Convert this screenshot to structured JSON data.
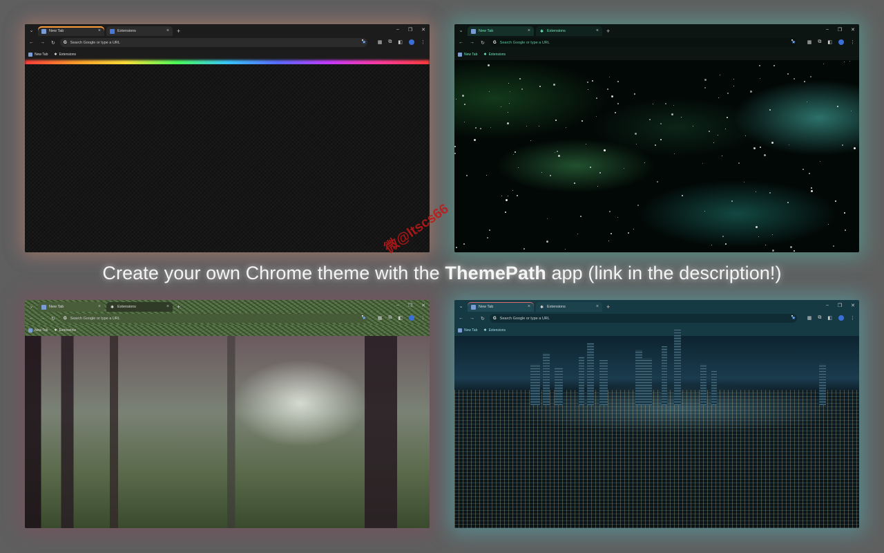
{
  "headline": {
    "before": "Create your own Chrome theme with the ",
    "app": "ThemePath",
    "after": " app (link in the description!)"
  },
  "watermark": "微@ltscs66",
  "browser": {
    "tab_new": "New Tab",
    "tab_extensions": "Extensions",
    "omnibox_placeholder": "Search Google or type a URL",
    "bookmark_new_tab": "New Tab",
    "bookmark_extensions": "Extensions",
    "new_tab_plus": "+",
    "close": "×",
    "minimize": "–",
    "maximize": "❐",
    "window_close": "✕"
  },
  "themes": [
    {
      "name": "dark-rainbow",
      "accent": "#ff9c3a"
    },
    {
      "name": "galaxy",
      "accent": "#6ee6b8"
    },
    {
      "name": "forest",
      "accent": "#556b45"
    },
    {
      "name": "city-night",
      "accent": "#163a44"
    }
  ]
}
